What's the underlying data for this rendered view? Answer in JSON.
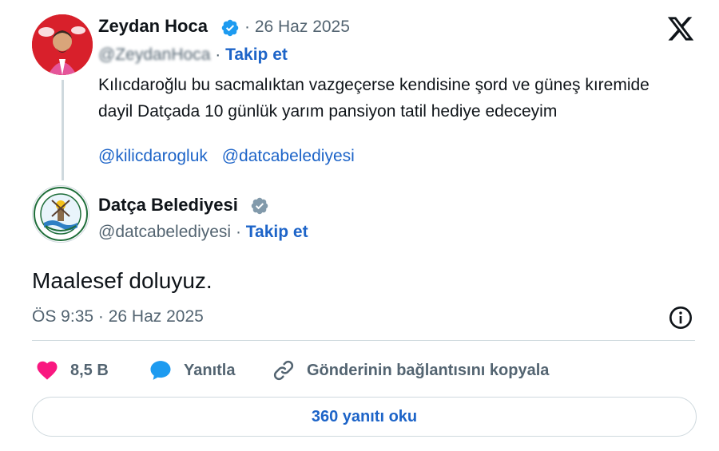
{
  "quoted_tweet": {
    "author_name": "Zeydan Hoca",
    "verified_badge": "blue-verified-badge-icon",
    "date": "· 26 Haz 2025",
    "handle": "@ZeydanHoca",
    "separator": "·",
    "follow_label": "Takip et",
    "text": "Kılıcdaroğlu bu sacmalıktan  vazgeçerse  kendisine şord ve güneş kıremide dayil Datçada  10 günlük yarım pansiyon tatil hediye edeceyim",
    "mentions": [
      "@kilicdarogluk",
      "@datcabelediyesi"
    ]
  },
  "main_tweet": {
    "author_name": "Datça Belediyesi",
    "verified_badge": "gray-verified-badge-icon",
    "handle": "@datcabelediyesi",
    "separator": "·",
    "follow_label": "Takip et",
    "text": "Maalesef doluyuz.",
    "timestamp": "ÖS 9:35 · 26 Haz 2025"
  },
  "actions": {
    "like_count": "8,5 B",
    "reply_label": "Yanıtla",
    "copy_link_label": "Gönderinin bağlantısını kopyala"
  },
  "read_replies_label": "360 yanıtı oku",
  "colors": {
    "link_blue": "#1d64c8",
    "like_pink": "#f91880",
    "reply_blue": "#1d9bf0",
    "secondary_text": "#536471",
    "border": "#cfd9de"
  }
}
